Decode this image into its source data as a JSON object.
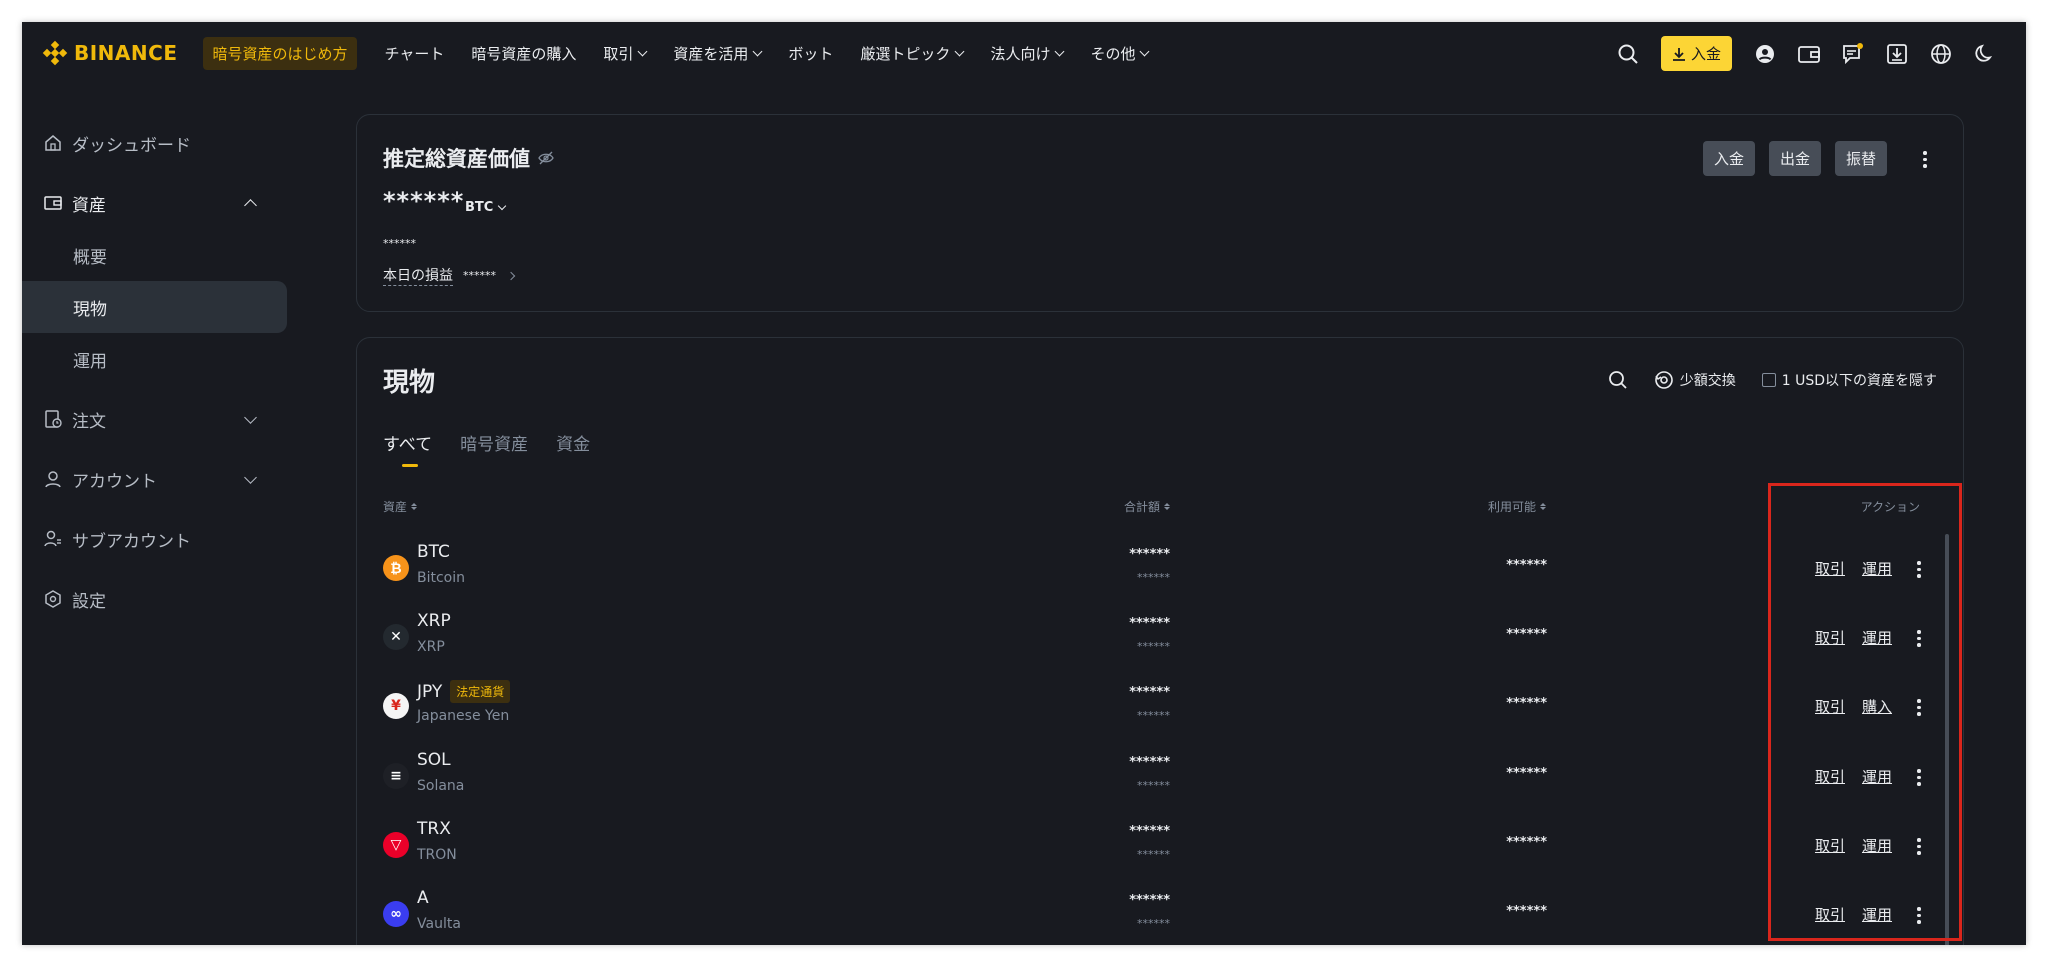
{
  "nav": {
    "brand": "BINANCE",
    "beginner": "暗号資産のはじめ方",
    "links": [
      {
        "label": "チャート",
        "dropdown": false
      },
      {
        "label": "暗号資産の購入",
        "dropdown": false
      },
      {
        "label": "取引",
        "dropdown": true
      },
      {
        "label": "資産を活用",
        "dropdown": true
      },
      {
        "label": "ボット",
        "dropdown": false
      },
      {
        "label": "厳選トピック",
        "dropdown": true
      },
      {
        "label": "法人向け",
        "dropdown": true
      },
      {
        "label": "その他",
        "dropdown": true
      }
    ],
    "deposit": "入金",
    "icons": [
      "search-icon",
      "user-icon",
      "wallet-icon",
      "message-icon",
      "download-icon",
      "globe-icon",
      "moon-icon"
    ]
  },
  "sidebar": {
    "dashboard": "ダッシュボード",
    "assets": "資産",
    "overview": "概要",
    "spot": "現物",
    "earn": "運用",
    "orders": "注文",
    "account": "アカウント",
    "subaccount": "サブアカウント",
    "settings": "設定"
  },
  "estimate": {
    "title": "推定総資産価値",
    "value": "******",
    "unit": "BTC",
    "sub": "******",
    "pnl_label": "本日の損益",
    "pnl_value": "******",
    "buttons": [
      "入金",
      "出金",
      "振替"
    ]
  },
  "spot": {
    "title": "現物",
    "convert": "少額交換",
    "hide_small": "1 USD以下の資産を隠す",
    "tabs": [
      "すべて",
      "暗号資産",
      "資金"
    ],
    "headers": {
      "asset": "資産",
      "total": "合計額",
      "available": "利用可能",
      "action": "アクション"
    },
    "rows": [
      {
        "symbol": "BTC",
        "name": "Bitcoin",
        "badge": "",
        "total": "******",
        "total_sub": "******",
        "available": "******",
        "action1": "取引",
        "action2": "運用",
        "color": "#f7931a",
        "glyph": "₿"
      },
      {
        "symbol": "XRP",
        "name": "XRP",
        "badge": "",
        "total": "******",
        "total_sub": "******",
        "available": "******",
        "action1": "取引",
        "action2": "運用",
        "color": "#23292f",
        "glyph": "✕"
      },
      {
        "symbol": "JPY",
        "name": "Japanese Yen",
        "badge": "法定通貨",
        "total": "******",
        "total_sub": "******",
        "available": "******",
        "action1": "取引",
        "action2": "購入",
        "color": "#f5f5f5",
        "glyph": "¥"
      },
      {
        "symbol": "SOL",
        "name": "Solana",
        "badge": "",
        "total": "******",
        "total_sub": "******",
        "available": "******",
        "action1": "取引",
        "action2": "運用",
        "color": "#1e2026",
        "glyph": "≡"
      },
      {
        "symbol": "TRX",
        "name": "TRON",
        "badge": "",
        "total": "******",
        "total_sub": "******",
        "available": "******",
        "action1": "取引",
        "action2": "運用",
        "color": "#eb0029",
        "glyph": "▽"
      },
      {
        "symbol": "A",
        "name": "Vaulta",
        "badge": "",
        "total": "******",
        "total_sub": "******",
        "available": "******",
        "action1": "取引",
        "action2": "運用",
        "color": "#3a3df0",
        "glyph": "∞"
      }
    ]
  },
  "colors": {
    "accent": "#f0b90b",
    "bg": "#181a20",
    "highlight": "#d9261c"
  }
}
